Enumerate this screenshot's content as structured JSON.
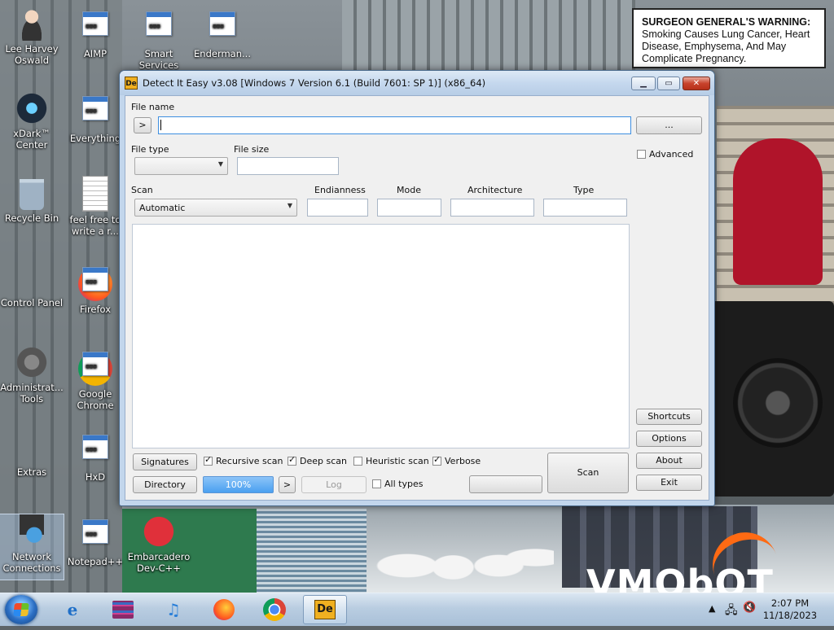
{
  "desktop": {
    "icons": [
      {
        "label": "Lee Harvey Oswald"
      },
      {
        "label": "AIMP"
      },
      {
        "label": "Smart Services"
      },
      {
        "label": "Enderman..."
      },
      {
        "label": "xDark™ Center"
      },
      {
        "label": "Everything"
      },
      {
        "label": "Recycle Bin"
      },
      {
        "label": "feel free to write a r..."
      },
      {
        "label": "Control Panel"
      },
      {
        "label": "Firefox"
      },
      {
        "label": "Administrat... Tools"
      },
      {
        "label": "Google Chrome"
      },
      {
        "label": "Extras"
      },
      {
        "label": "HxD"
      },
      {
        "label": "Network Connections"
      },
      {
        "label": "Notepad++"
      },
      {
        "label": "Embarcadero Dev-C++"
      }
    ],
    "warning": {
      "lead": "SURGEON GENERAL'S WARNING:",
      "text": "Smoking Causes Lung Cancer, Heart Disease, Emphysema, And May Complicate Pregnancy."
    },
    "watermark": "VMObOT"
  },
  "window": {
    "title": "Detect It Easy v3.08 [Windows 7 Version 6.1 (Build 7601: SP 1)] (x86_64)",
    "icon_text": "De",
    "file_name_label": "File name",
    "file_name_value": "",
    "browse_label": "...",
    "history_label": ">",
    "file_type_label": "File type",
    "file_type_value": "",
    "file_size_label": "File size",
    "file_size_value": "",
    "scan_label": "Scan",
    "scan_value": "Automatic",
    "endianness_label": "Endianness",
    "mode_label": "Mode",
    "architecture_label": "Architecture",
    "type_label": "Type",
    "advanced_label": "Advanced",
    "signatures_label": "Signatures",
    "recursive_label": "Recursive scan",
    "deep_label": "Deep scan",
    "heuristic_label": "Heuristic scan",
    "verbose_label": "Verbose",
    "directory_label": "Directory",
    "progress_text": "100%",
    "next_label": ">",
    "log_label": "Log",
    "alltypes_label": "All types",
    "scan_button_label": "Scan",
    "shortcuts_label": "Shortcuts",
    "options_label": "Options",
    "about_label": "About",
    "exit_label": "Exit",
    "checks": {
      "recursive": true,
      "deep": true,
      "heuristic": false,
      "verbose": true,
      "alltypes": false,
      "advanced": false
    }
  },
  "taskbar": {
    "apps": [
      "start-button",
      "internet-explorer-icon",
      "winrar-icon",
      "music-player-icon",
      "firefox-icon",
      "chrome-icon",
      "detect-it-easy-icon"
    ],
    "die_icon_text": "De",
    "time": "2:07 PM",
    "date": "11/18/2023"
  },
  "colors": {
    "accent": "#3d8ee0",
    "progress": "#4aa0f0",
    "close": "#c8432c"
  }
}
